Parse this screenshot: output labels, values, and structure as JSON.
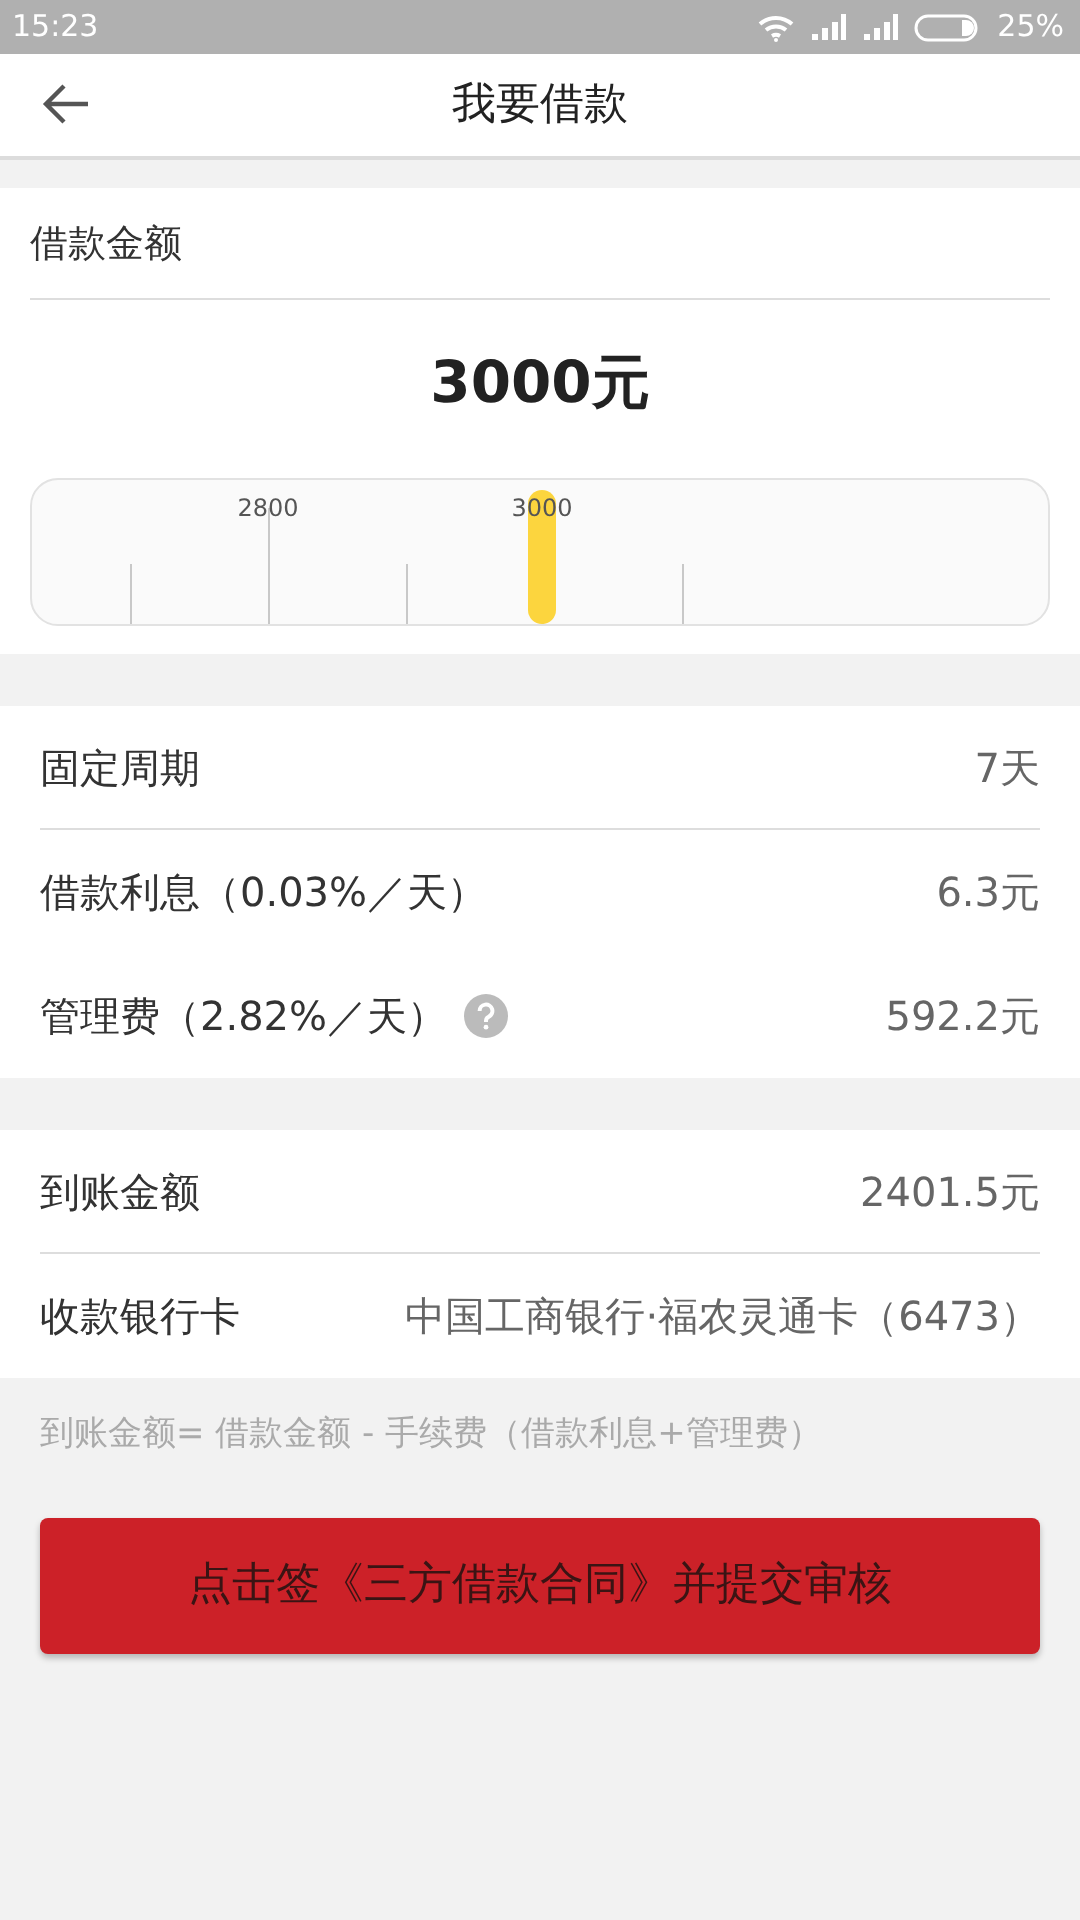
{
  "status_bar": {
    "time": "15:23",
    "battery": "25%"
  },
  "header": {
    "title": "我要借款"
  },
  "amount_card": {
    "label": "借款金额",
    "amount": "3000元",
    "ruler": {
      "level": 0.5,
      "tick_labels": [
        "2800",
        "3000"
      ]
    }
  },
  "terms": [
    {
      "label": "固定周期",
      "value": "7天",
      "divider": true
    },
    {
      "label": "借款利息（0.03%／天）",
      "value": "6.3元"
    },
    {
      "label": "管理费（2.82%／天）",
      "value": "592.2元",
      "help": true
    }
  ],
  "receipt": [
    {
      "label": "到账金额",
      "value": "2401.5元",
      "divider": true
    },
    {
      "label": "收款银行卡",
      "value": "中国工商银行·福农灵通卡（6473）"
    }
  ],
  "note": "到账金额= 借款金额 - 手续费（借款利息+管理费）",
  "submit_button": "点击签《三方借款合同》并提交审核"
}
